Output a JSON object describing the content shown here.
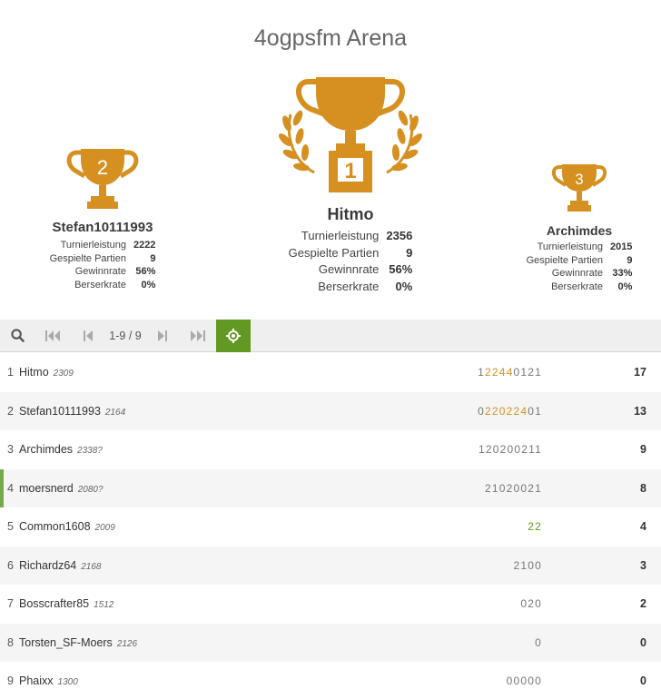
{
  "title": "4ogpsfm Arena",
  "podium": {
    "first": {
      "place": "1",
      "name": "Hitmo",
      "stats": [
        {
          "label": "Turnierleistung",
          "value": "2356"
        },
        {
          "label": "Gespielte Partien",
          "value": "9"
        },
        {
          "label": "Gewinnrate",
          "value": "56%"
        },
        {
          "label": "Berserkrate",
          "value": "0%"
        }
      ]
    },
    "second": {
      "place": "2",
      "name": "Stefan10111993",
      "stats": [
        {
          "label": "Turnierleistung",
          "value": "2222"
        },
        {
          "label": "Gespielte Partien",
          "value": "9"
        },
        {
          "label": "Gewinnrate",
          "value": "56%"
        },
        {
          "label": "Berserkrate",
          "value": "0%"
        }
      ]
    },
    "third": {
      "place": "3",
      "name": "Archimdes",
      "stats": [
        {
          "label": "Turnierleistung",
          "value": "2015"
        },
        {
          "label": "Gespielte Partien",
          "value": "9"
        },
        {
          "label": "Gewinnrate",
          "value": "33%"
        },
        {
          "label": "Berserkrate",
          "value": "0%"
        }
      ]
    }
  },
  "toolbar": {
    "search_icon": "search-icon",
    "first_icon": "first-page-icon",
    "prev_icon": "previous-page-icon",
    "page_indicator": "1-9 / 9",
    "next_icon": "next-page-icon",
    "last_icon": "last-page-icon",
    "me_icon": "target-icon",
    "accent_color": "#629924"
  },
  "colors": {
    "trophy": "#d59020",
    "streak_double": "#d59020",
    "streak_fire": "#629924",
    "highlight_border": "#76a94a"
  },
  "standings": [
    {
      "rank": "1",
      "name": "Hitmo",
      "rating": "2309",
      "sheet": [
        [
          "1",
          "n"
        ],
        [
          "2",
          "d"
        ],
        [
          "2",
          "d"
        ],
        [
          "4",
          "d"
        ],
        [
          "4",
          "d"
        ],
        [
          "0",
          "n"
        ],
        [
          "1",
          "n"
        ],
        [
          "2",
          "n"
        ],
        [
          "1",
          "n"
        ]
      ],
      "total": "17",
      "me": false
    },
    {
      "rank": "2",
      "name": "Stefan10111993",
      "rating": "2164",
      "sheet": [
        [
          "0",
          "n"
        ],
        [
          "2",
          "d"
        ],
        [
          "2",
          "d"
        ],
        [
          "0",
          "d"
        ],
        [
          "2",
          "d"
        ],
        [
          "2",
          "d"
        ],
        [
          "4",
          "d"
        ],
        [
          "0",
          "n"
        ],
        [
          "1",
          "n"
        ]
      ],
      "total": "13",
      "me": false
    },
    {
      "rank": "3",
      "name": "Archimdes",
      "rating": "2338?",
      "sheet": [
        [
          "1",
          "n"
        ],
        [
          "2",
          "n"
        ],
        [
          "0",
          "n"
        ],
        [
          "2",
          "n"
        ],
        [
          "0",
          "n"
        ],
        [
          "0",
          "n"
        ],
        [
          "2",
          "n"
        ],
        [
          "1",
          "n"
        ],
        [
          "1",
          "n"
        ]
      ],
      "total": "9",
      "me": false
    },
    {
      "rank": "4",
      "name": "moersnerd",
      "rating": "2080?",
      "sheet": [
        [
          "2",
          "n"
        ],
        [
          "1",
          "n"
        ],
        [
          "0",
          "n"
        ],
        [
          "2",
          "n"
        ],
        [
          "0",
          "n"
        ],
        [
          "0",
          "n"
        ],
        [
          "2",
          "n"
        ],
        [
          "1",
          "n"
        ]
      ],
      "total": "8",
      "me": true
    },
    {
      "rank": "5",
      "name": "Common1608",
      "rating": "2009",
      "sheet": [
        [
          "2",
          "f"
        ],
        [
          "2",
          "f"
        ]
      ],
      "total": "4",
      "me": false
    },
    {
      "rank": "6",
      "name": "Richardz64",
      "rating": "2168",
      "sheet": [
        [
          "2",
          "n"
        ],
        [
          "1",
          "n"
        ],
        [
          "0",
          "n"
        ],
        [
          "0",
          "n"
        ]
      ],
      "total": "3",
      "me": false
    },
    {
      "rank": "7",
      "name": "Bosscrafter85",
      "rating": "1512",
      "sheet": [
        [
          "0",
          "n"
        ],
        [
          "2",
          "n"
        ],
        [
          "0",
          "n"
        ]
      ],
      "total": "2",
      "me": false
    },
    {
      "rank": "8",
      "name": "Torsten_SF-Moers",
      "rating": "2126",
      "sheet": [
        [
          "0",
          "n"
        ]
      ],
      "total": "0",
      "me": false
    },
    {
      "rank": "9",
      "name": "Phaixx",
      "rating": "1300",
      "sheet": [
        [
          "0",
          "n"
        ],
        [
          "0",
          "n"
        ],
        [
          "0",
          "n"
        ],
        [
          "0",
          "n"
        ],
        [
          "0",
          "n"
        ]
      ],
      "total": "0",
      "me": false
    }
  ]
}
